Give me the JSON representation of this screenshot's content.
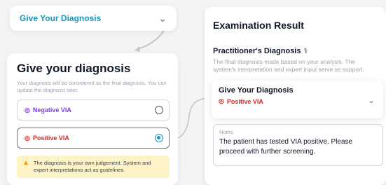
{
  "top_dropdown": {
    "label": "Give Your Diagnosis"
  },
  "diagnosis_card": {
    "title": "Give your diagnosis",
    "description": "Your diagnosis will be considered as the final diagnosis. You can update the diagnosis later.",
    "options": [
      {
        "label": "Negative VIA",
        "selected": false
      },
      {
        "label": "Positive VIA",
        "selected": true
      }
    ],
    "warning": "The diagnosis is your own judgement. System and expert interpretations act as guidelines."
  },
  "exam_card": {
    "title": "Examination Result",
    "section_title": "Practitioner's Diagnosis",
    "section_desc": "The final diagnosis made based on your analysis. The system's interpretation and expert input serve as support.",
    "dropdown": {
      "title": "Give Your Diagnosis",
      "value": "Positive VIA"
    },
    "notes": {
      "label": "Notes",
      "text": "The patient has tested VIA positive. Please proceed with further screening."
    }
  }
}
